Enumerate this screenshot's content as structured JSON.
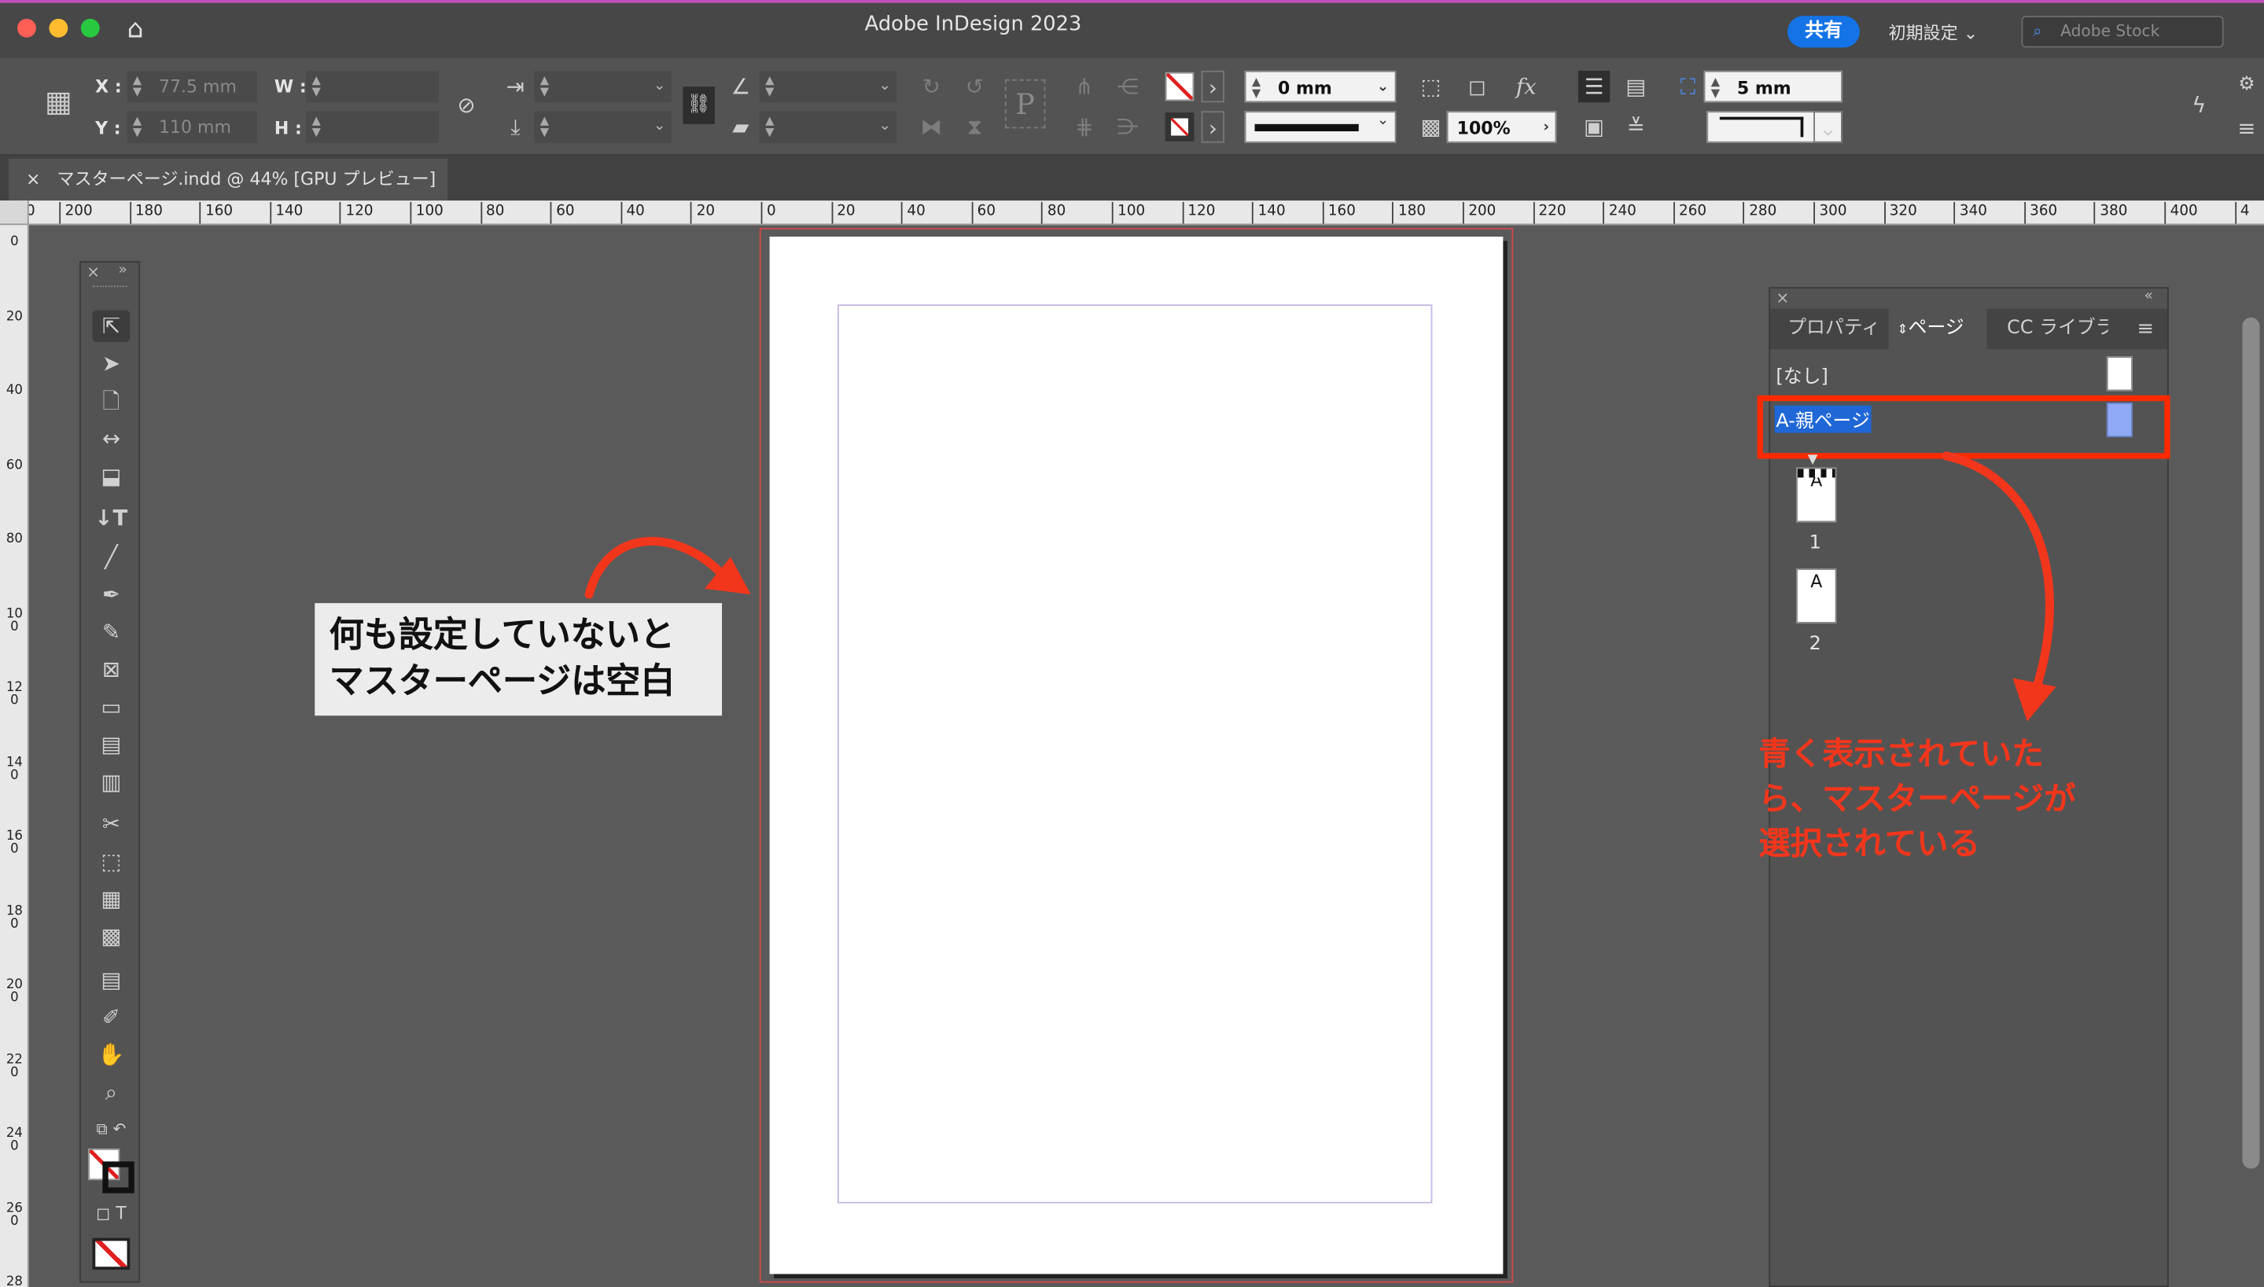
{
  "app": {
    "title": "Adobe InDesign 2023",
    "share_label": "共有",
    "workspace_label": "初期設定",
    "stock_placeholder": "Adobe Stock"
  },
  "control": {
    "x_label": "X :",
    "x_value": "77.5 mm",
    "y_label": "Y :",
    "y_value": "110 mm",
    "w_label": "W :",
    "h_label": "H :",
    "stroke_weight": "0 mm",
    "opacity": "100%",
    "inset": "5 mm",
    "p_icon": "P"
  },
  "document_tab": {
    "close": "×",
    "label": "マスターページ.indd @ 44% [GPU プレビュー]"
  },
  "ruler_h": [
    "0",
    "200",
    "180",
    "160",
    "140",
    "120",
    "100",
    "80",
    "60",
    "40",
    "20",
    "0",
    "20",
    "40",
    "60",
    "80",
    "100",
    "120",
    "140",
    "160",
    "180",
    "200",
    "220",
    "240",
    "260",
    "280",
    "300",
    "320",
    "340",
    "360",
    "380",
    "400",
    "4"
  ],
  "ruler_v": [
    "0",
    "20",
    "40",
    "60",
    "80",
    "100",
    "120",
    "140",
    "160",
    "180",
    "200",
    "220",
    "240",
    "260",
    "280"
  ],
  "annotation_left": {
    "line1": "何も設定していないと",
    "line2": "マスターページは空白"
  },
  "pages_panel": {
    "tabs": [
      "プロパティ",
      "ページ",
      "CC ライブラ"
    ],
    "none_label": "[なし]",
    "parent_label": "A-親ページ",
    "pages": [
      {
        "prefix": "A",
        "number": "1"
      },
      {
        "prefix": "A",
        "number": "2"
      }
    ]
  },
  "annotation_right": {
    "line1": "青く表示されていた",
    "line2": "ら、マスターページが",
    "line3": "選択されている"
  },
  "colors": {
    "accent_blue": "#1473e6",
    "selection_blue": "#1f67d6",
    "parent_swatch": "#8fa9f5",
    "annotation_red": "#f2361c"
  }
}
